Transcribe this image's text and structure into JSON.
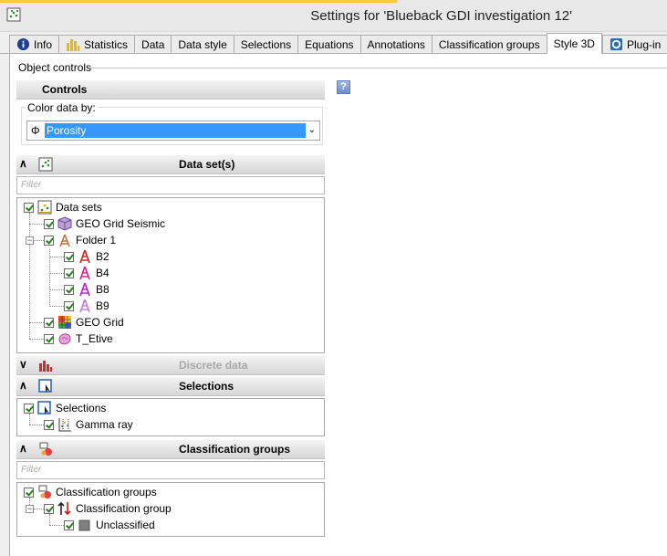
{
  "window": {
    "title": "Settings for 'Blueback GDI investigation 12'"
  },
  "tabs": [
    {
      "label": "Info",
      "icon": "info-icon"
    },
    {
      "label": "Statistics",
      "icon": "statistics-icon"
    },
    {
      "label": "Data"
    },
    {
      "label": "Data style"
    },
    {
      "label": "Selections"
    },
    {
      "label": "Equations"
    },
    {
      "label": "Annotations"
    },
    {
      "label": "Classification groups"
    },
    {
      "label": "Style 3D",
      "active": true
    },
    {
      "label": "Plug-in",
      "icon": "plugin-icon"
    }
  ],
  "object_controls": {
    "label": "Object controls",
    "controls_header": "Controls",
    "color_by_label": "Color data by:",
    "color_by_symbol": "Φ",
    "color_by_value": "Porosity",
    "datasets_header": "Data set(s)",
    "filter_placeholder": "Filter",
    "discrete_header": "Discrete data",
    "selections_header": "Selections",
    "classification_header": "Classification groups"
  },
  "datasets_tree": [
    {
      "label": "Data sets",
      "icon": "datasets-icon"
    },
    {
      "label": "GEO Grid Seismic",
      "icon": "seismic-cube-icon"
    },
    {
      "label": "Folder 1",
      "icon": "folder-icon"
    },
    {
      "label": "B2",
      "icon": "well-icon"
    },
    {
      "label": "B4",
      "icon": "well-icon"
    },
    {
      "label": "B8",
      "icon": "well-icon"
    },
    {
      "label": "B9",
      "icon": "well-icon"
    },
    {
      "label": "GEO Grid",
      "icon": "grid-icon"
    },
    {
      "label": "T_Etive",
      "icon": "surface-icon"
    }
  ],
  "selections_tree": [
    {
      "label": "Selections",
      "icon": "selection-icon"
    },
    {
      "label": "Gamma ray",
      "icon": "crossplot-icon"
    }
  ],
  "classification_tree": [
    {
      "label": "Classification groups",
      "icon": "classification-groups-icon"
    },
    {
      "label": "Classification group",
      "icon": "classification-group-icon"
    },
    {
      "label": "Unclassified",
      "icon": "gray-square-icon"
    }
  ],
  "help": {
    "label": "?"
  },
  "colors": {
    "selection": "#3399ff",
    "check": "#2a7d1e",
    "title_accent": "#f7c93b"
  }
}
